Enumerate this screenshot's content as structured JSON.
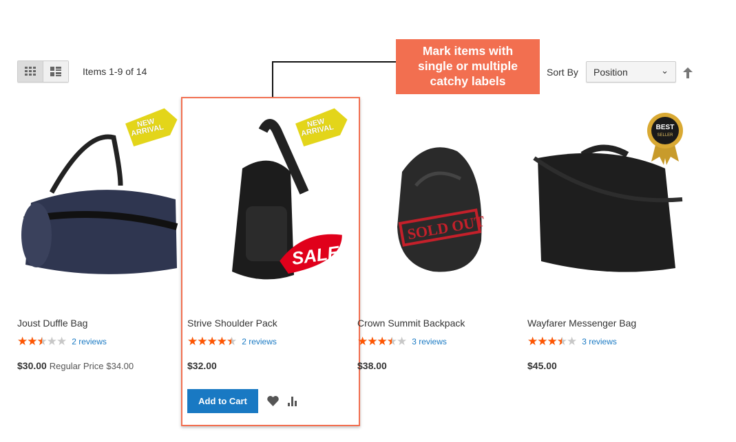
{
  "toolbar": {
    "modes": [
      {
        "name": "grid",
        "active": true
      },
      {
        "name": "list",
        "active": false
      }
    ],
    "amount": "Items 1-9 of 14",
    "sort_label": "Sort By",
    "sort_value": "Position",
    "sort_direction": "ascending"
  },
  "callout": {
    "lines": [
      "Mark items with",
      "single or multiple",
      "catchy labels"
    ],
    "color": "#f26f50"
  },
  "products": [
    {
      "name": "Joust Duffle Bag",
      "rating": 2.5,
      "reviews": "2 reviews",
      "price": "$30.00",
      "regular_label": "Regular Price",
      "regular_price": "$34.00",
      "labels": [
        "NEW ARRIVAL"
      ]
    },
    {
      "name": "Strive Shoulder Pack",
      "rating": 4.5,
      "reviews": "2 reviews",
      "price": "$32.00",
      "labels": [
        "NEW ARRIVAL",
        "SALE"
      ],
      "add_to_cart": "Add to Cart",
      "highlighted": true
    },
    {
      "name": "Crown Summit Backpack",
      "rating": 3.5,
      "reviews": "3 reviews",
      "price": "$38.00",
      "labels": [
        "SOLD OUT"
      ]
    },
    {
      "name": "Wayfarer Messenger Bag",
      "rating": 3.5,
      "reviews": "3 reviews",
      "price": "$45.00",
      "labels": [
        "BEST SELLER"
      ]
    }
  ],
  "colors": {
    "accent": "#1979c3",
    "star": "#ff5501",
    "label_orange": "#f26f50"
  }
}
